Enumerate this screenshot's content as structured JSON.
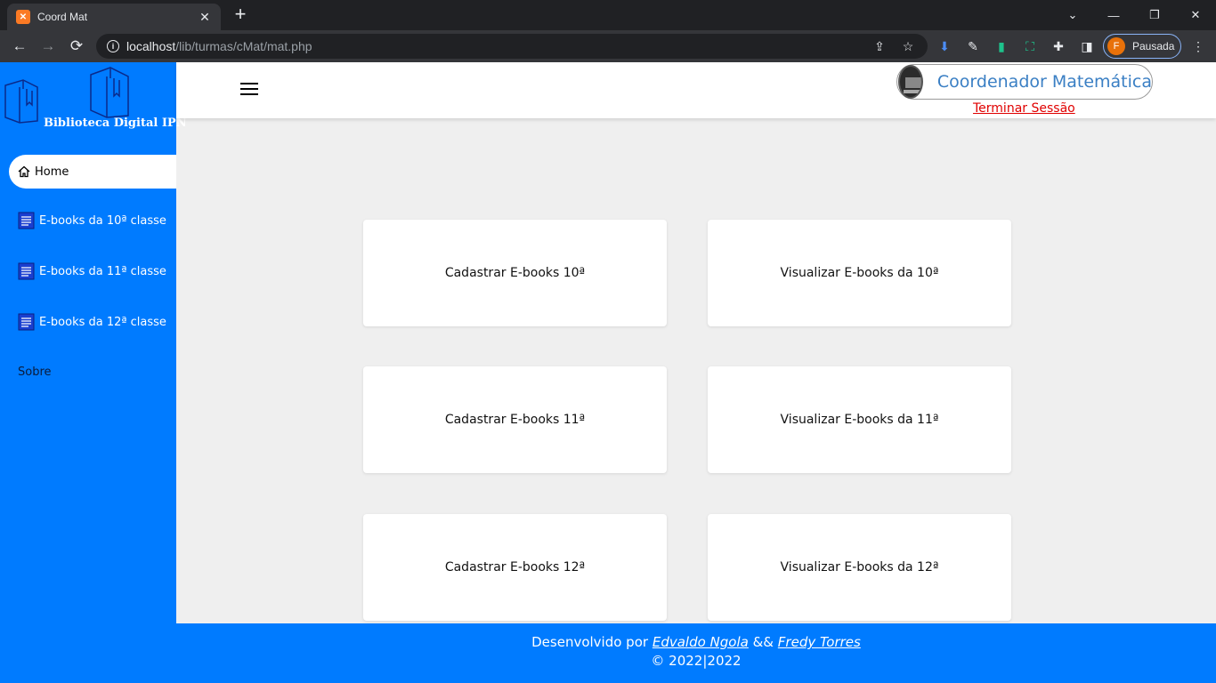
{
  "browser": {
    "tab_title": "Coord Mat",
    "tab_favicon": "xampp",
    "new_tab": "+",
    "url_host": "localhost",
    "url_path": "/lib/turmas/cMat/mat.php",
    "profile_initial": "F",
    "profile_label": "Pausada",
    "win_controls": {
      "dropdown": "⌄",
      "minimize": "—",
      "restore": "❐",
      "close": "✕"
    },
    "nav": {
      "back": "←",
      "forward": "→",
      "reload": "⟳"
    }
  },
  "sidebar": {
    "logo_text": "Biblioteca Digital IPN",
    "items": [
      {
        "label": "Home",
        "icon": "home-icon"
      },
      {
        "label": "E-books da 10ª classe",
        "icon": "document-icon"
      },
      {
        "label": "E-books da 11ª classe",
        "icon": "document-icon"
      },
      {
        "label": "E-books da 12ª classe",
        "icon": "document-icon"
      },
      {
        "label": "Sobre"
      }
    ]
  },
  "header": {
    "user_name": "Coordenador Matemática",
    "logout": "Terminar Sessão"
  },
  "cards": [
    {
      "label": "Cadastrar E-books 10ª"
    },
    {
      "label": "Visualizar E-books da 10ª"
    },
    {
      "label": "Cadastrar E-books 11ª"
    },
    {
      "label": "Visualizar E-books da 11ª"
    },
    {
      "label": "Cadastrar E-books 12ª"
    },
    {
      "label": "Visualizar E-books da 12ª"
    }
  ],
  "footer": {
    "prefix": "Desenvolvido por",
    "author1": "Edvaldo Ngola",
    "separator": "&&",
    "author2": "Fredy Torres",
    "copyright": "© 2022|2022"
  },
  "colors": {
    "sidebar_bg": "#007bff",
    "page_bg": "#efefef",
    "logout": "#e00000",
    "user_name": "#3a7fc4"
  }
}
